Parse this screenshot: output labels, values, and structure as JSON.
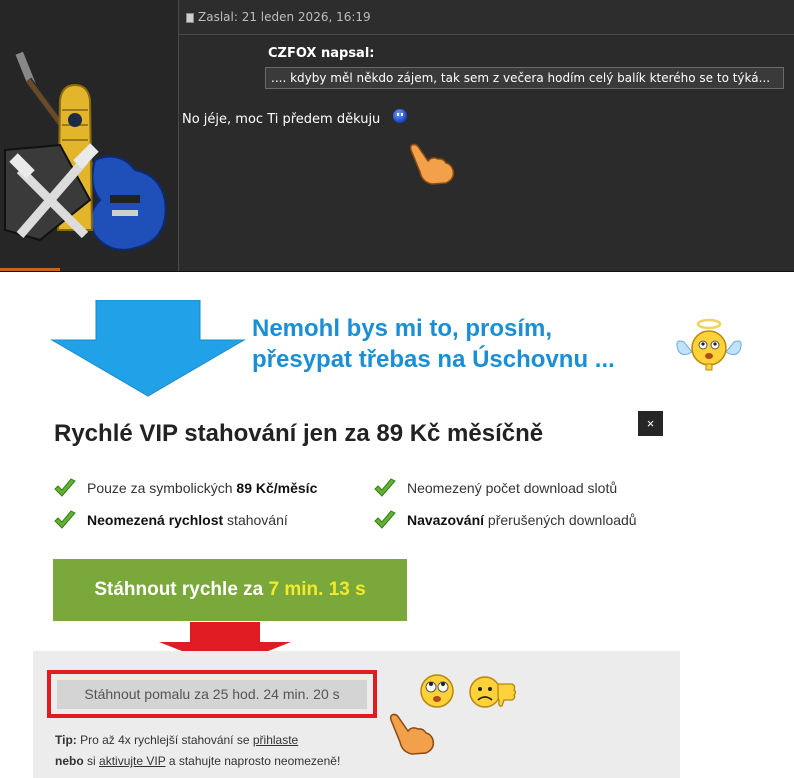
{
  "forum": {
    "post_meta": "Zaslal: 21 leden 2026, 16:19",
    "quote_author": "CZFOX napsal:",
    "quote_text": ".... kdyby měl někdo zájem, tak sem z večera hodím celý balík kterého se to týká...",
    "post_text": "No jéje, moc Ti předem děkuju"
  },
  "message": {
    "line1": "Nemohl bys mi to, prosím,",
    "line2": "přesypat třebas na Úschovnu ..."
  },
  "vip": {
    "title": "Rychlé VIP stahování jen za 89 Kč měsíčně",
    "close_label": "×",
    "features": [
      {
        "pre": "Pouze za symbolických ",
        "bold": "89 Kč/měsíc",
        "post": ""
      },
      {
        "pre": "Neomezený počet download slotů",
        "bold": "",
        "post": ""
      },
      {
        "pre": "",
        "bold": "Neomezená rychlost",
        "post": " stahování"
      },
      {
        "pre": "",
        "bold": "Navazování",
        "post": " přerušených downloadů"
      }
    ],
    "fast_button": {
      "prefix": "Stáhnout rychle za ",
      "time": "7 min. 13 s"
    },
    "slow_button": "Stáhnout pomalu za 25 hod. 24 min. 20 s",
    "tip": {
      "label": "Tip:",
      "text1": " Pro až 4x rychlejší stahování se ",
      "link1": "přihlaste",
      "text2_bold": "nebo",
      "text2": " si ",
      "link2": "aktivujte VIP",
      "text3": " a stahujte naprosto neomezeně!"
    }
  },
  "colors": {
    "forum_bg": "#2b2b2b",
    "message_blue": "#1a8fd6",
    "fast_green": "#7aa83a",
    "highlight_yellow": "#f3ea2a",
    "frame_red": "#e11b22"
  }
}
